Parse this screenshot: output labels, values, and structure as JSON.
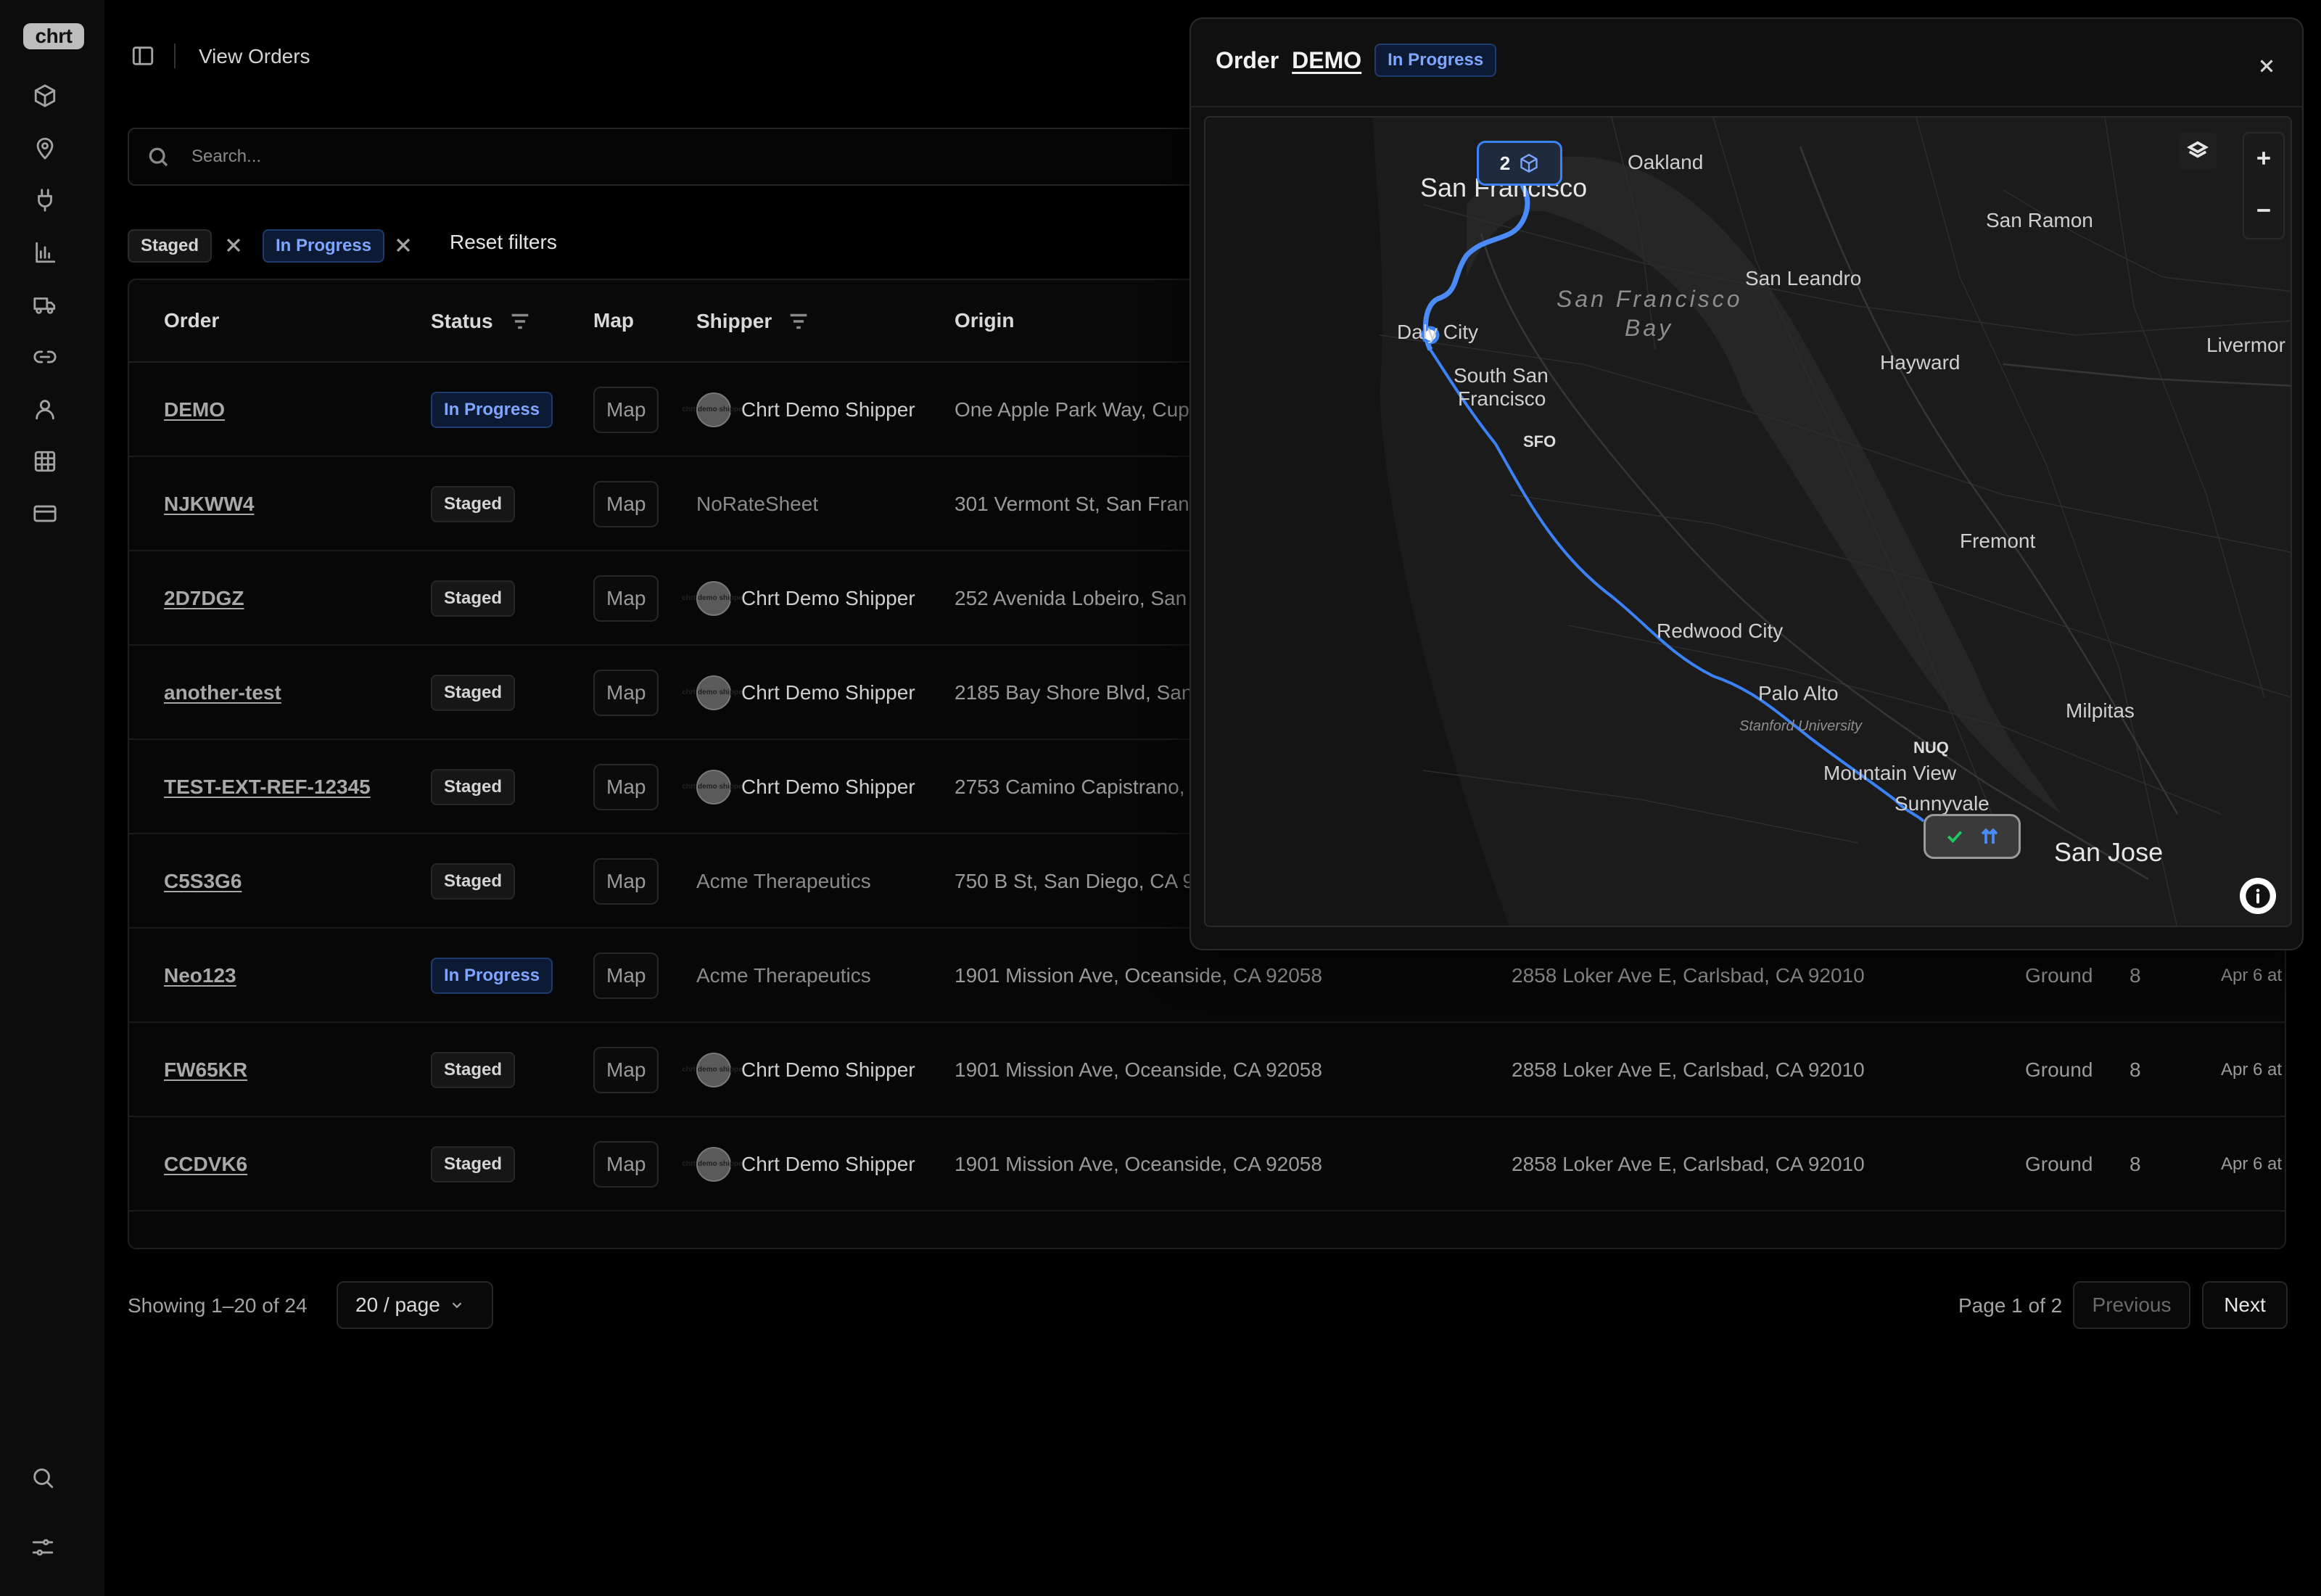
{
  "app": {
    "logo": "chrt"
  },
  "header": {
    "title": "View Orders"
  },
  "search": {
    "placeholder": "Search..."
  },
  "filters": {
    "chips": [
      "Staged",
      "In Progress"
    ],
    "reset_label": "Reset filters"
  },
  "table": {
    "columns": [
      "Order",
      "Status",
      "Map",
      "Shipper",
      "Origin"
    ],
    "avatar_text": "chrt demo shipper",
    "rows": [
      {
        "order": "DEMO",
        "status": "In Progress",
        "map": "Map",
        "shipper": "Chrt Demo Shipper",
        "origin": "One Apple Park Way, Cup",
        "destination": "",
        "service": "",
        "qty": "",
        "date": ""
      },
      {
        "order": "NJKWW4",
        "status": "Staged",
        "map": "Map",
        "shipper": "NoRateSheet",
        "origin": "301 Vermont St, San Fran",
        "destination": "",
        "service": "",
        "qty": "",
        "date": ""
      },
      {
        "order": "2D7DGZ",
        "status": "Staged",
        "map": "Map",
        "shipper": "Chrt Demo Shipper",
        "origin": "252 Avenida Lobeiro, San",
        "destination": "",
        "service": "",
        "qty": "",
        "date": ""
      },
      {
        "order": "another-test",
        "status": "Staged",
        "map": "Map",
        "shipper": "Chrt Demo Shipper",
        "origin": "2185 Bay Shore Blvd, San",
        "destination": "",
        "service": "",
        "qty": "",
        "date": ""
      },
      {
        "order": "TEST-EXT-REF-12345",
        "status": "Staged",
        "map": "Map",
        "shipper": "Chrt Demo Shipper",
        "origin": "2753 Camino Capistrano,",
        "destination": "",
        "service": "",
        "qty": "",
        "date": ""
      },
      {
        "order": "C5S3G6",
        "status": "Staged",
        "map": "Map",
        "shipper": "Acme Therapeutics",
        "origin": "750 B St, San Diego, CA 9",
        "destination": "",
        "service": "",
        "qty": "",
        "date": ""
      },
      {
        "order": "Neo123",
        "status": "In Progress",
        "map": "Map",
        "shipper": "Acme Therapeutics",
        "origin": "1901 Mission Ave, Oceanside, CA 92058",
        "destination": "2858 Loker Ave E, Carlsbad, CA 92010",
        "service": "Ground",
        "qty": "8",
        "date": "Apr 6 at"
      },
      {
        "order": "FW65KR",
        "status": "Staged",
        "map": "Map",
        "shipper": "Chrt Demo Shipper",
        "origin": "1901 Mission Ave, Oceanside, CA 92058",
        "destination": "2858 Loker Ave E, Carlsbad, CA 92010",
        "service": "Ground",
        "qty": "8",
        "date": "Apr 6 at"
      },
      {
        "order": "CCDVK6",
        "status": "Staged",
        "map": "Map",
        "shipper": "Chrt Demo Shipper",
        "origin": "1901 Mission Ave, Oceanside, CA 92058",
        "destination": "2858 Loker Ave E, Carlsbad, CA 92010",
        "service": "Ground",
        "qty": "8",
        "date": "Apr 6 at"
      }
    ]
  },
  "pagination": {
    "showing": "Showing 1–20 of 24",
    "per_page": "20 / page",
    "page_info": "Page 1 of 2",
    "previous": "Previous",
    "next": "Next"
  },
  "modal": {
    "title_prefix": "Order",
    "order_id": "DEMO",
    "status": "In Progress",
    "cluster_count": "2",
    "map_labels": {
      "sf": "San Francisco",
      "oakland": "Oakland",
      "san_ramon": "San Ramon",
      "san_leandro": "San Leandro",
      "bay": "San Francisco",
      "bay2": "Bay",
      "daly_city": "Daly City",
      "hayward": "Hayward",
      "livermore": "Livermor",
      "south_sf_1": "South San",
      "south_sf_2": "Francisco",
      "sfo": "SFO",
      "fremont": "Fremont",
      "redwood_city": "Redwood City",
      "palo_alto": "Palo Alto",
      "stanford": "Stanford University",
      "nuq": "NUQ",
      "milpitas": "Milpitas",
      "mountain_view": "Mountain View",
      "sunnyvale": "Sunnyvale",
      "san_jose": "San Jose"
    }
  },
  "colors": {
    "accent": "#3b82f6",
    "progress_text": "#7fa6ff",
    "check_green": "#22c55e"
  }
}
